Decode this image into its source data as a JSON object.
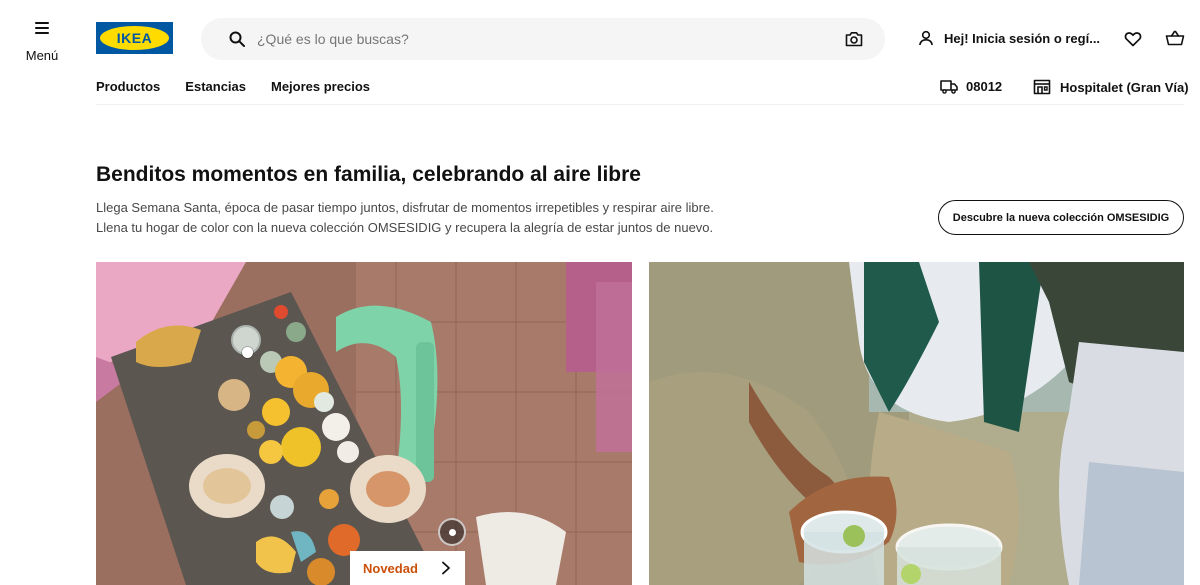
{
  "header": {
    "menu_label": "Menú",
    "logo_text": "IKEA",
    "search": {
      "placeholder": "¿Qué es lo que buscas?"
    },
    "login_label": "Hej! Inicia sesión o regí..."
  },
  "nav": {
    "items": [
      {
        "label": "Productos"
      },
      {
        "label": "Estancias"
      },
      {
        "label": "Mejores precios"
      }
    ],
    "postal_code": "08012",
    "store_name": "Hospitalet (Gran Vía)"
  },
  "hero": {
    "title": "Benditos momentos en familia, celebrando al aire libre",
    "description_line1": "Llega Semana Santa, época de pasar tiempo juntos, disfrutar de momentos irrepetibles y respirar aire libre.",
    "description_line2": "Llena tu hogar de color con la nueva colección OMSESIDIG y recupera la alegría de estar juntos de nuevo.",
    "cta_label": "Descubre la nueva colección OMSESIDIG"
  },
  "promo": {
    "tag_label": "Novedad"
  },
  "colors": {
    "ikea_blue": "#0058a3",
    "ikea_yellow": "#ffdb00",
    "novedad_orange": "#ca5008",
    "search_bg": "#f5f5f5"
  },
  "icons": [
    "hamburger-icon",
    "search-icon",
    "camera-icon",
    "user-icon",
    "heart-icon",
    "cart-icon",
    "truck-icon",
    "store-icon",
    "chevron-right-icon"
  ]
}
